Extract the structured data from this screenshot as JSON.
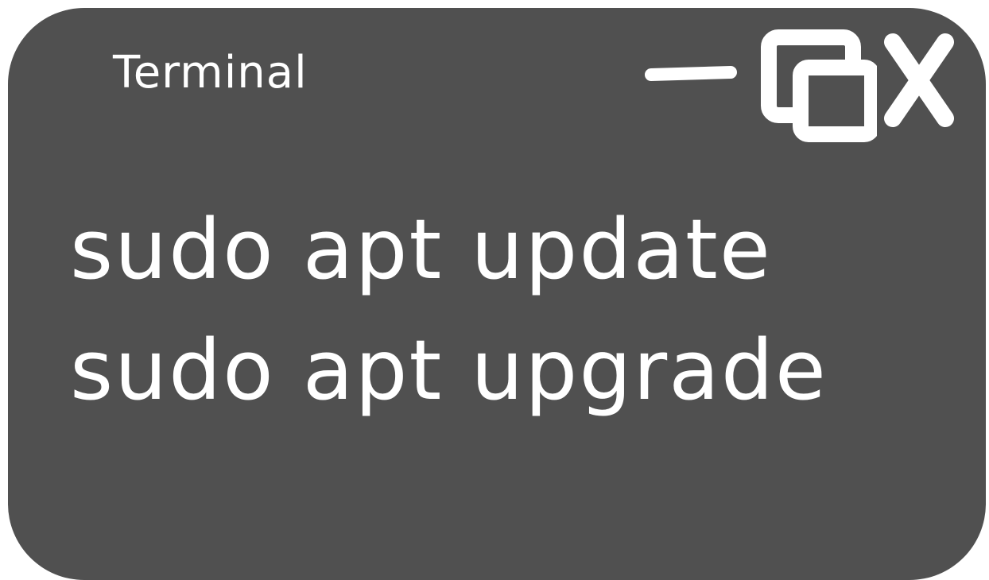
{
  "window": {
    "title": "Terminal",
    "background_color": "#505050",
    "text_color": "#ffffff"
  },
  "controls": {
    "minimize_icon": "minimize-icon",
    "restore_icon": "restore-icon",
    "close_icon": "close-icon"
  },
  "terminal": {
    "lines": [
      "sudo apt update",
      "sudo apt upgrade"
    ]
  }
}
